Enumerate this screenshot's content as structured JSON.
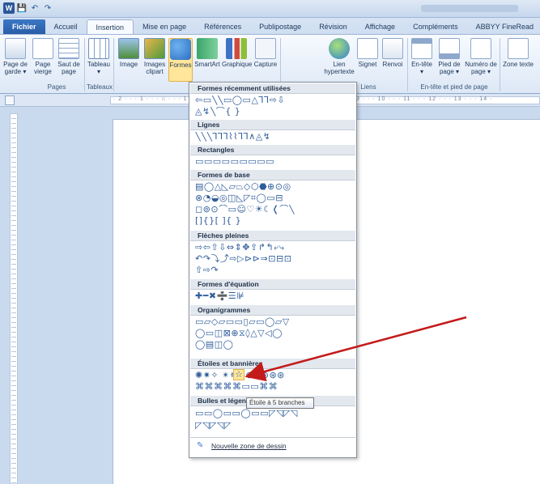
{
  "qat": {
    "save_icon": "💾",
    "undo_icon": "↶",
    "redo_icon": "↷",
    "logo": "W"
  },
  "tabs": [
    "Fichier",
    "Accueil",
    "Insertion",
    "Mise en page",
    "Références",
    "Publipostage",
    "Révision",
    "Affichage",
    "Compléments",
    "ABBYY FineRead"
  ],
  "ribbon": {
    "buttons": [
      {
        "label": "Page de garde ▾",
        "x": 0
      },
      {
        "label": "Page vierge",
        "x": 1
      },
      {
        "label": "Saut de page",
        "x": 2
      },
      {
        "label": "Tableau ▾",
        "x": 3
      },
      {
        "label": "Image",
        "x": 4
      },
      {
        "label": "Images clipart",
        "x": 5
      },
      {
        "label": "Formes",
        "x": 6
      },
      {
        "label": "SmartArt",
        "x": 7
      },
      {
        "label": "Graphique",
        "x": 8
      },
      {
        "label": "Capture",
        "x": 9
      },
      {
        "label": "Lien hypertexte",
        "x": 10
      },
      {
        "label": "Signet",
        "x": 11
      },
      {
        "label": "Renvoi",
        "x": 12
      },
      {
        "label": "En-tête ▾",
        "x": 13
      },
      {
        "label": "Pied de page ▾",
        "x": 14
      },
      {
        "label": "Numéro de page ▾",
        "x": 15
      },
      {
        "label": "Zone texte",
        "x": 16
      }
    ],
    "groups": {
      "pages": "Pages",
      "tableaux": "Tableaux",
      "liens": "Liens",
      "entete": "En-tête et pied de page"
    }
  },
  "ruler": {
    "ticks": "· 2 · · · 1 · · · ⌂ · · · 1 · · · 2 · · · 3 · · · 4 · · · 5 · · · 6 · · · 7 · · · 8 · · · 9 · · · 10 · · · 11 · · · 12 · · · 13 · · · 14 ·"
  },
  "dropdown": {
    "sections": [
      {
        "title": "Formes récemment utilisées",
        "rows": [
          "⇦▭╲╲▭◯▭△⅂⅂⇨⇩",
          "◬↯╲⌒{ }"
        ]
      },
      {
        "title": "Lignes",
        "rows": [
          "╲╲╲⅂⅂⅂⌇⌇⅂⅂∧◬↯"
        ]
      },
      {
        "title": "Rectangles",
        "rows": [
          "▭▭▭▭▭▭▭▭▭"
        ]
      },
      {
        "title": "Formes de base",
        "rows": [
          "▤◯△◺▱⏢◇⬡⬣⊕⊙◎",
          "⊗◔◒◎◫◺◸⌗◯▭⊟",
          "◻⊚⊙⌒▭☺♡☀☾❬⌒╲",
          "[]{}[ ]{ }"
        ]
      },
      {
        "title": "Flèches pleines",
        "rows": [
          "⇨⇦⇧⇩⇔⇕✥⇪↱↰⤶⤷",
          "↶↷⤵⤴⇨▷⊳⊳⇒⊡⊟⊡",
          "⇧⇨↷"
        ]
      },
      {
        "title": "Formes d'équation",
        "rows": [
          "✚━✖➗☰⊯"
        ]
      },
      {
        "title": "Organigrammes",
        "rows": [
          "▭▱◇▱▭▭▯▱▭◯▱▽",
          "◯▭◫⊠⊕⧖◊△▽◁◯",
          "◯▤◫◯"
        ]
      },
      {
        "title": "Étoiles et bannières",
        "rows": [
          "✺✷✧    ✴✵⊛⊛⊛⊛⊛⊛",
          "⌘⌘⌘⌘⌘▭▭⌘⌘"
        ]
      },
      {
        "title": "Bulles et légendes",
        "rows": [
          "▭▭◯▭▭◯▭▭◸◹◸◹",
          "◸◹◸◹◸"
        ]
      }
    ],
    "highlighted_star": "☆",
    "tooltip": "Étoile à 5 branches",
    "new_canvas_label": "Nouvelle zone de dessin",
    "new_canvas_icon": "✎"
  }
}
